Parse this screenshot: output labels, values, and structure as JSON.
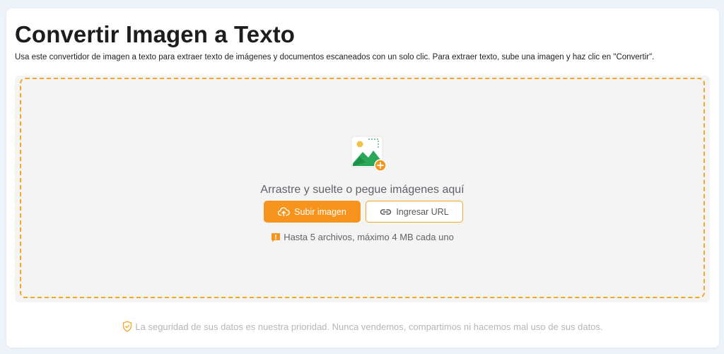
{
  "header": {
    "title": "Convertir Imagen a Texto",
    "subtitle": "Usa este convertidor de imagen a texto para extraer texto de imágenes y documentos escaneados con un solo clic. Para extraer texto, sube una imagen y haz clic en \"Convertir\"."
  },
  "dropzone": {
    "prompt": "Arrastre y suelte o pegue imágenes aquí",
    "upload_button_label": "Subir imagen",
    "url_button_label": "Ingresar URL",
    "limit_note": "Hasta 5 archivos, máximo 4 MB cada uno",
    "icons": {
      "illustration": "image-upload-icon",
      "upload": "cloud-upload-icon",
      "url": "link-icon",
      "note": "alert-icon"
    }
  },
  "footer": {
    "security_note": "La seguridad de sus datos es nuestra prioridad. Nunca vendemos, compartimos ni hacemos mal uso de sus datos.",
    "icon": "shield-icon"
  },
  "colors": {
    "accent": "#f7941d",
    "page_background": "#eef3f9",
    "dropzone_background": "#f4f4f4"
  }
}
